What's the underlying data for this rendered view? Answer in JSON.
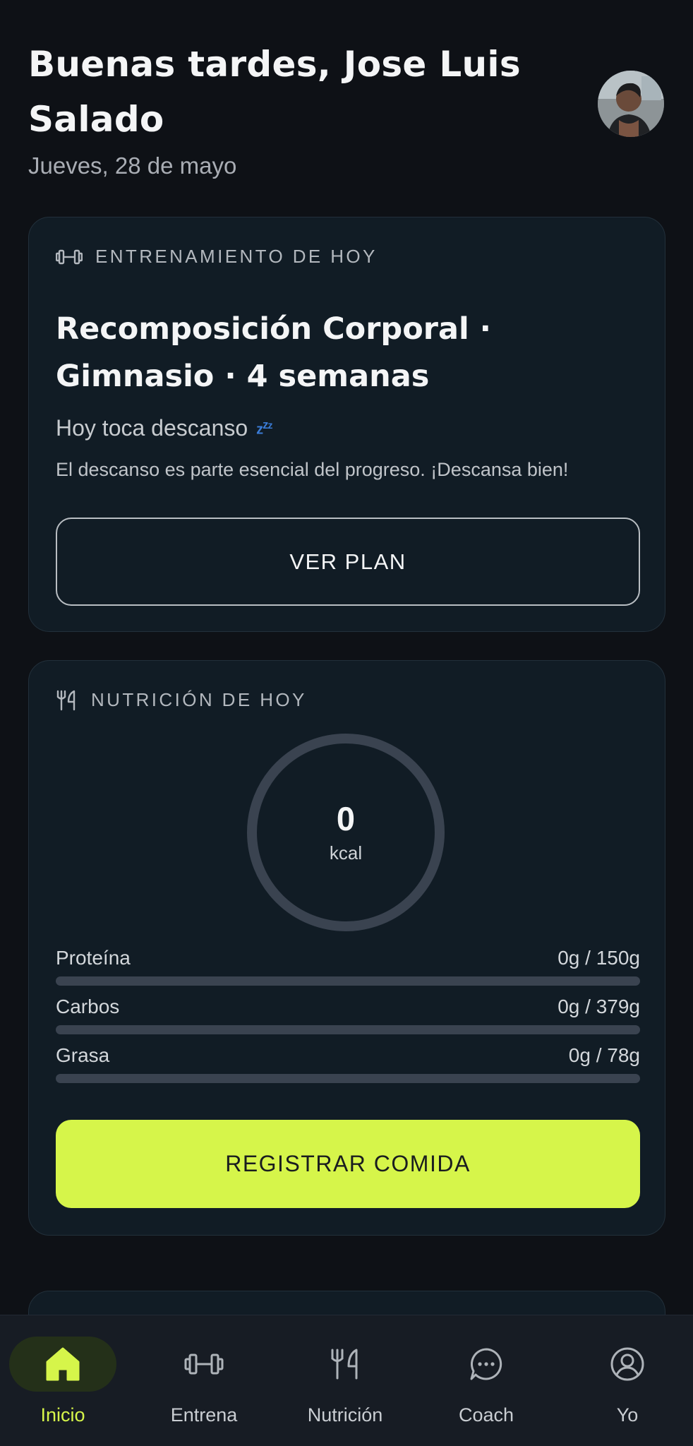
{
  "header": {
    "greeting": "Buenas tardes, Jose Luis Salado",
    "date": "Jueves, 28 de mayo"
  },
  "workout": {
    "section_label": "ENTRENAMIENTO DE HOY",
    "plan_title": "Recomposición Corporal · Gimnasio · 4 semanas",
    "rest_status": "Hoy toca descanso",
    "rest_description": "El descanso es parte esencial del progreso. ¡Descansa bien!",
    "view_plan_label": "VER PLAN"
  },
  "nutrition": {
    "section_label": "NUTRICIÓN DE HOY",
    "calories_value": "0",
    "calories_unit": "kcal",
    "macros": [
      {
        "name": "Proteína",
        "value": "0g / 150g",
        "progress": 0
      },
      {
        "name": "Carbos",
        "value": "0g / 379g",
        "progress": 0
      },
      {
        "name": "Grasa",
        "value": "0g / 78g",
        "progress": 0
      }
    ],
    "log_meal_label": "REGISTRAR COMIDA"
  },
  "nav": {
    "items": [
      {
        "label": "Inicio",
        "icon": "home-icon",
        "active": true
      },
      {
        "label": "Entrena",
        "icon": "dumbbell-icon",
        "active": false
      },
      {
        "label": "Nutrición",
        "icon": "fork-knife-icon",
        "active": false
      },
      {
        "label": "Coach",
        "icon": "chat-bubble-icon",
        "active": false
      },
      {
        "label": "Yo",
        "icon": "user-icon",
        "active": false
      }
    ]
  },
  "colors": {
    "background": "#0e1116",
    "card": "#111c25",
    "accent": "#d6f54a",
    "muted_track": "#3a4350"
  }
}
